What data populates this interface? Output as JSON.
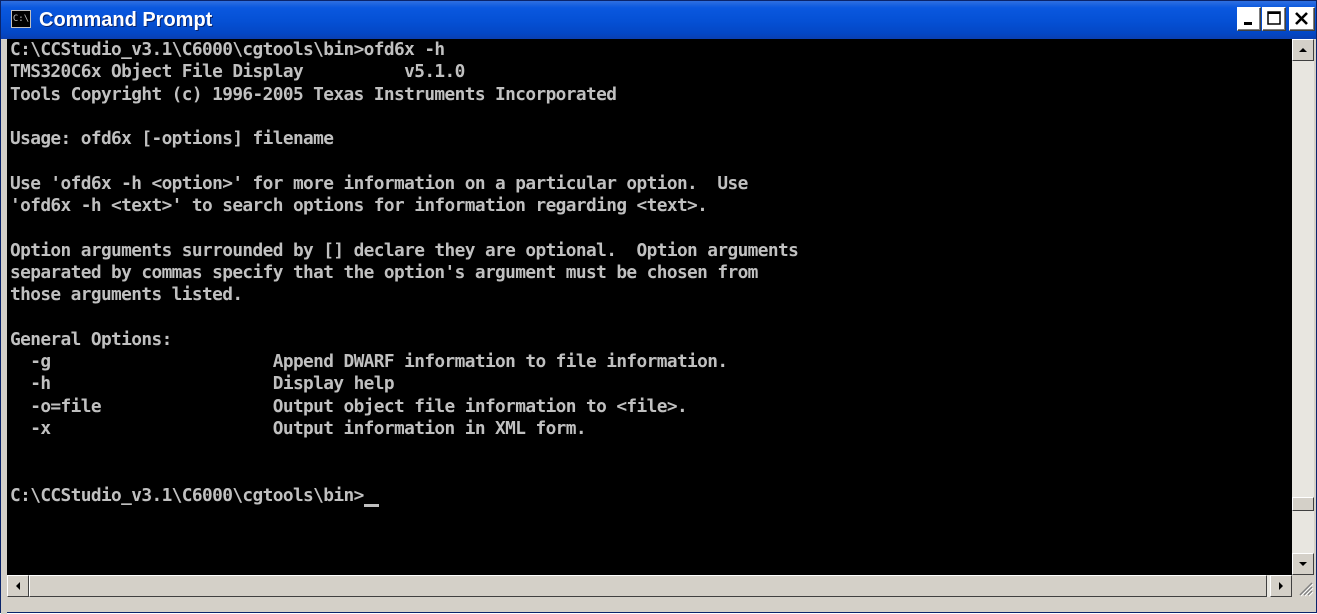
{
  "window": {
    "title": "Command Prompt",
    "icon_text": "C:\\"
  },
  "title_buttons": {
    "minimize": "minimize-icon",
    "maximize": "maximize-icon",
    "close": "close-icon"
  },
  "console": {
    "lines": [
      "C:\\CCStudio_v3.1\\C6000\\cgtools\\bin>ofd6x -h",
      "TMS320C6x Object File Display          v5.1.0",
      "Tools Copyright (c) 1996-2005 Texas Instruments Incorporated",
      "",
      "Usage: ofd6x [-options] filename",
      "",
      "Use 'ofd6x -h <option>' for more information on a particular option.  Use",
      "'ofd6x -h <text>' to search options for information regarding <text>.",
      "",
      "Option arguments surrounded by [] declare they are optional.  Option arguments",
      "separated by commas specify that the option's argument must be chosen from",
      "those arguments listed.",
      "",
      "General Options:",
      "  -g                      Append DWARF information to file information.",
      "  -h                      Display help",
      "  -o=file                 Output object file information to <file>.",
      "  -x                      Output information in XML form.",
      "",
      "",
      "C:\\CCStudio_v3.1\\C6000\\cgtools\\bin>"
    ]
  },
  "colors": {
    "title_bar": "#0551d6",
    "console_bg": "#000000",
    "console_fg": "#c0c0c0",
    "close_button": "#c0c0c0"
  }
}
